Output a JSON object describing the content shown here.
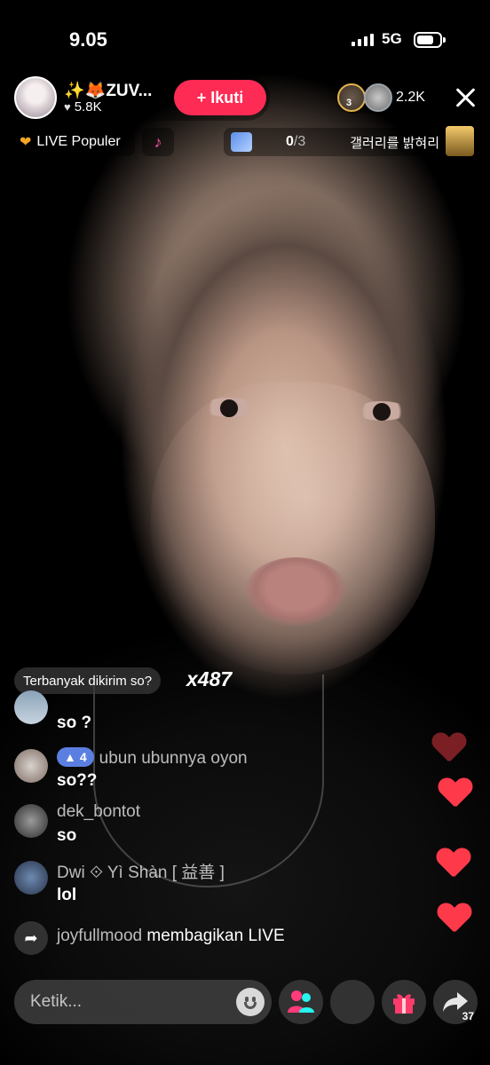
{
  "status": {
    "time": "9.05",
    "network": "5G"
  },
  "host": {
    "name": "✨🦊ZUV...",
    "likes": "5.8K",
    "follow_label": "+ Ikuti"
  },
  "viewers": {
    "rank": "3",
    "count": "2.2K"
  },
  "chips": {
    "live_popular": "LIVE Populer",
    "gallery_progress": "0",
    "gallery_total": "/3",
    "gallery_label": "갤러리를 밝혀리"
  },
  "top_gift": {
    "label": "Terbanyak dikirim so?",
    "multiplier": "x487"
  },
  "chat": [
    {
      "name": "",
      "message": "so ?"
    },
    {
      "name": "ubun ubunnya oyon",
      "level": "4",
      "message": "so??"
    },
    {
      "name": "dek_bontot",
      "message": "so"
    },
    {
      "name": "Dwi ⟐ Yì Shàn [ 益善 ]",
      "message": "lol"
    }
  ],
  "share_event": {
    "user": "joyfullmood",
    "action": "membagikan LIVE"
  },
  "input": {
    "placeholder": "Ketik..."
  },
  "share_count": "37",
  "icons": [
    "heart-icon",
    "music-icon",
    "emoji-icon",
    "guests-icon",
    "gift-icon",
    "share-icon",
    "close-icon"
  ],
  "colors": {
    "follow": "#fe2c55",
    "heart": "#fe3a4a",
    "level_badge": "#5b7fe0"
  }
}
